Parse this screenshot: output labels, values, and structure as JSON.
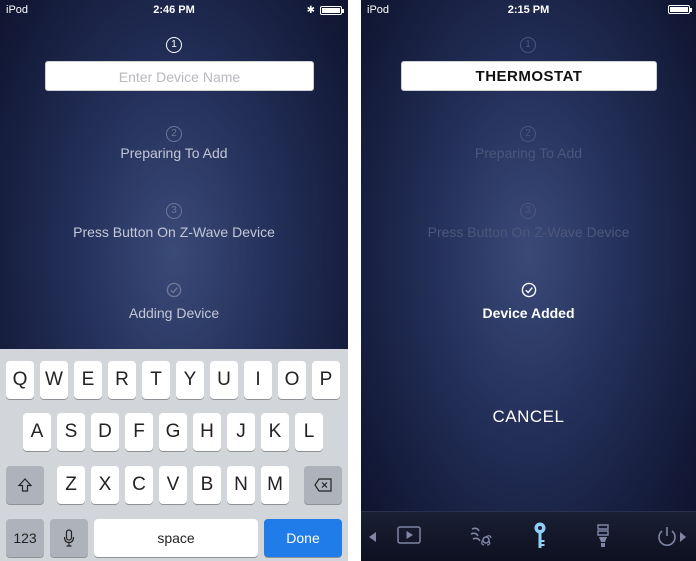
{
  "left_screen": {
    "status": {
      "carrier": "iPod",
      "time": "2:46 PM"
    },
    "steps": [
      {
        "number": "1"
      },
      {
        "number": "2",
        "label": "Preparing To Add"
      },
      {
        "number": "3",
        "label": "Press Button On Z-Wave Device"
      },
      {
        "label": "Adding Device"
      }
    ],
    "name_field": {
      "placeholder": "Enter Device Name"
    },
    "keyboard": {
      "row1": [
        "Q",
        "W",
        "E",
        "R",
        "T",
        "Y",
        "U",
        "I",
        "O",
        "P"
      ],
      "row2": [
        "A",
        "S",
        "D",
        "F",
        "G",
        "H",
        "J",
        "K",
        "L"
      ],
      "row3": [
        "Z",
        "X",
        "C",
        "V",
        "B",
        "N",
        "M"
      ],
      "numbers_label": "123",
      "space_label": "space",
      "done_label": "Done"
    }
  },
  "right_screen": {
    "status": {
      "carrier": "iPod",
      "time": "2:15 PM"
    },
    "name_field": {
      "value": "THERMOSTAT"
    },
    "steps": [
      {
        "number": "1"
      },
      {
        "number": "2",
        "label": "Preparing To Add"
      },
      {
        "number": "3",
        "label": "Press Button On Z-Wave Device"
      },
      {
        "label": "Device Added"
      }
    ],
    "cancel_label": "CANCEL",
    "tab_bar": [
      "arrow-left-icon",
      "play-icon",
      "fan-icon",
      "key-icon",
      "bulb-icon",
      "power-icon"
    ]
  },
  "colors": {
    "active_text": "#ffffff",
    "dim_text": "#4c567a",
    "mid_text": "#c3c7d6",
    "accent": "#1f7ce8",
    "key_accent": "#8fd0f4"
  }
}
